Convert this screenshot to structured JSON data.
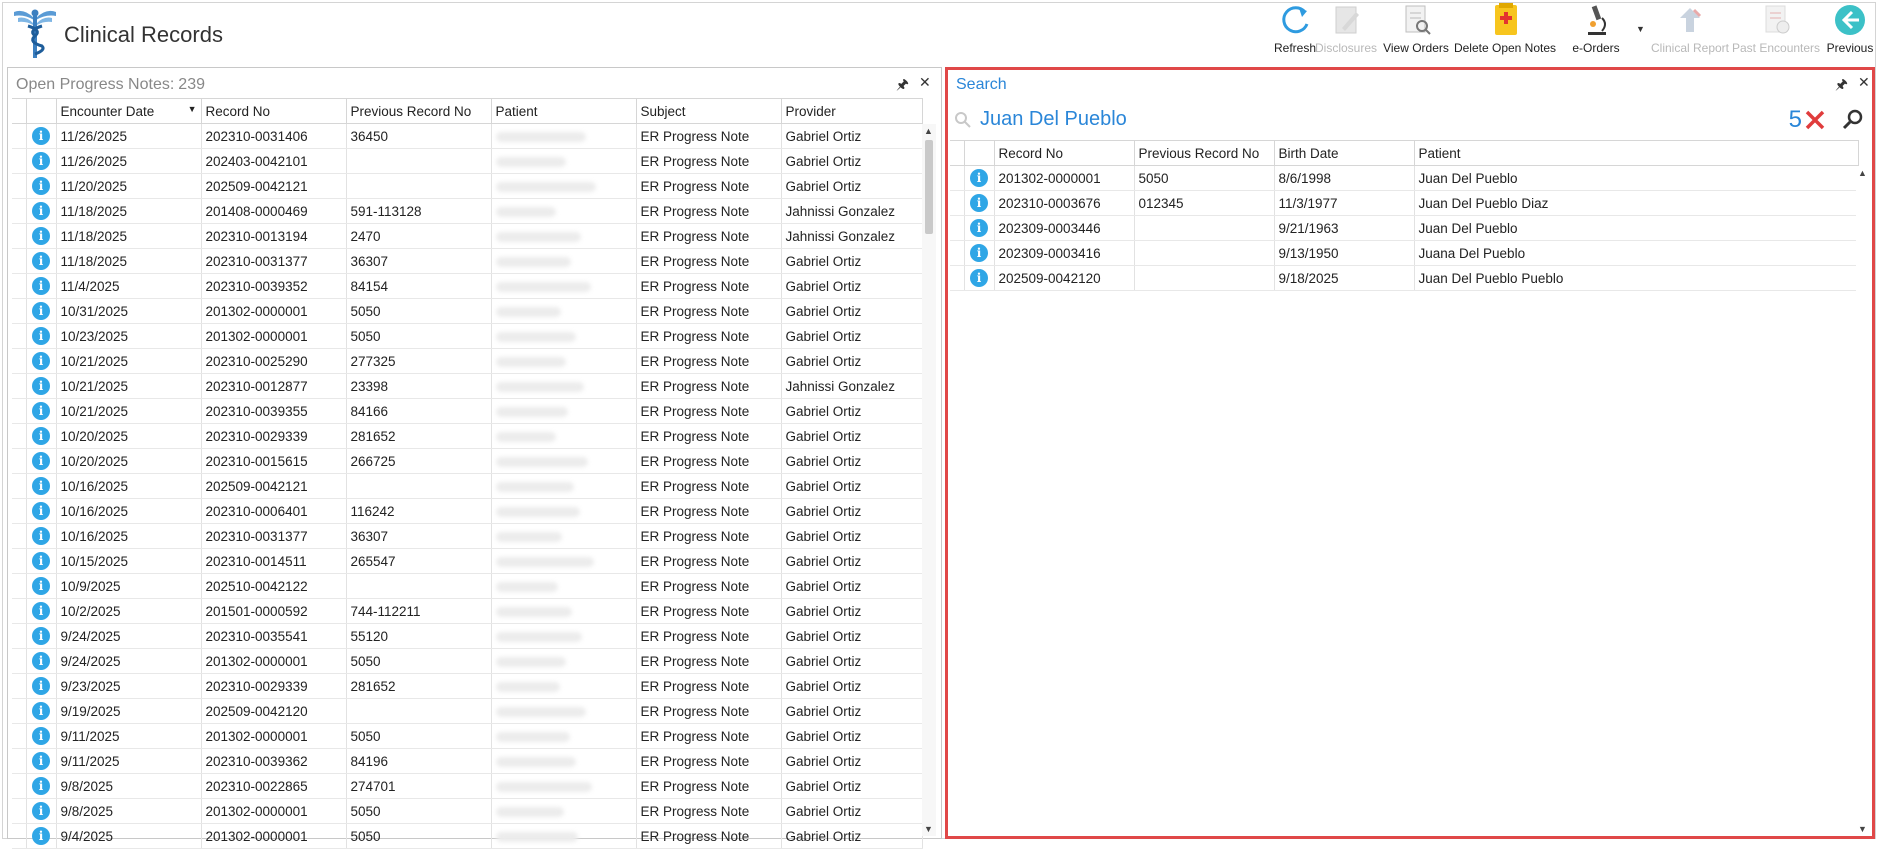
{
  "app": {
    "title": "Clinical Records"
  },
  "toolbar": [
    {
      "label": "Refresh",
      "icon": "refresh-icon",
      "enabled": true
    },
    {
      "label": "Disclosures",
      "icon": "disclosures-icon",
      "enabled": false
    },
    {
      "label": "View Orders",
      "icon": "view-orders-icon",
      "enabled": true
    },
    {
      "label": "Delete Open Notes",
      "icon": "delete-open-notes-icon",
      "enabled": true
    },
    {
      "label": "e-Orders",
      "icon": "microscope-icon",
      "enabled": true
    },
    {
      "label": "Clinical Report",
      "icon": "clinical-report-icon",
      "enabled": false
    },
    {
      "label": "Past Encounters",
      "icon": "past-encounters-icon",
      "enabled": false
    },
    {
      "label": "Previous",
      "icon": "previous-arrow-icon",
      "enabled": true
    }
  ],
  "left_panel": {
    "title": "Open Progress Notes:",
    "count": "239",
    "columns": [
      "",
      "Encounter Date",
      "Record No",
      "Previous Record No",
      "Patient",
      "Subject",
      "Provider"
    ],
    "rows": [
      [
        "11/26/2025",
        "202310-0031406",
        "36450",
        "ER Progress Note",
        "Gabriel Ortiz"
      ],
      [
        "11/26/2025",
        "202403-0042101",
        "",
        "ER Progress Note",
        "Gabriel Ortiz"
      ],
      [
        "11/20/2025",
        "202509-0042121",
        "",
        "ER Progress Note",
        "Gabriel Ortiz"
      ],
      [
        "11/18/2025",
        "201408-0000469",
        "591-113128",
        "ER Progress Note",
        "Jahnissi Gonzalez"
      ],
      [
        "11/18/2025",
        "202310-0013194",
        "2470",
        "ER Progress Note",
        "Jahnissi Gonzalez"
      ],
      [
        "11/18/2025",
        "202310-0031377",
        "36307",
        "ER Progress Note",
        "Gabriel Ortiz"
      ],
      [
        "11/4/2025",
        "202310-0039352",
        "84154",
        "ER Progress Note",
        "Gabriel Ortiz"
      ],
      [
        "10/31/2025",
        "201302-0000001",
        "5050",
        "ER Progress Note",
        "Gabriel Ortiz"
      ],
      [
        "10/23/2025",
        "201302-0000001",
        "5050",
        "ER Progress Note",
        "Gabriel Ortiz"
      ],
      [
        "10/21/2025",
        "202310-0025290",
        "277325",
        "ER Progress Note",
        "Gabriel Ortiz"
      ],
      [
        "10/21/2025",
        "202310-0012877",
        "23398",
        "ER Progress Note",
        "Jahnissi Gonzalez"
      ],
      [
        "10/21/2025",
        "202310-0039355",
        "84166",
        "ER Progress Note",
        "Gabriel Ortiz"
      ],
      [
        "10/20/2025",
        "202310-0029339",
        "281652",
        "ER Progress Note",
        "Gabriel Ortiz"
      ],
      [
        "10/20/2025",
        "202310-0015615",
        "266725",
        "ER Progress Note",
        "Gabriel Ortiz"
      ],
      [
        "10/16/2025",
        "202509-0042121",
        "",
        "ER Progress Note",
        "Gabriel Ortiz"
      ],
      [
        "10/16/2025",
        "202310-0006401",
        "116242",
        "ER Progress Note",
        "Gabriel Ortiz"
      ],
      [
        "10/16/2025",
        "202310-0031377",
        "36307",
        "ER Progress Note",
        "Gabriel Ortiz"
      ],
      [
        "10/15/2025",
        "202310-0014511",
        "265547",
        "ER Progress Note",
        "Gabriel Ortiz"
      ],
      [
        "10/9/2025",
        "202510-0042122",
        "",
        "ER Progress Note",
        "Gabriel Ortiz"
      ],
      [
        "10/2/2025",
        "201501-0000592",
        "744-112211",
        "ER Progress Note",
        "Gabriel Ortiz"
      ],
      [
        "9/24/2025",
        "202310-0035541",
        "55120",
        "ER Progress Note",
        "Gabriel Ortiz"
      ],
      [
        "9/24/2025",
        "201302-0000001",
        "5050",
        "ER Progress Note",
        "Gabriel Ortiz"
      ],
      [
        "9/23/2025",
        "202310-0029339",
        "281652",
        "ER Progress Note",
        "Gabriel Ortiz"
      ],
      [
        "9/19/2025",
        "202509-0042120",
        "",
        "ER Progress Note",
        "Gabriel Ortiz"
      ],
      [
        "9/11/2025",
        "201302-0000001",
        "5050",
        "ER Progress Note",
        "Gabriel Ortiz"
      ],
      [
        "9/11/2025",
        "202310-0039362",
        "84196",
        "ER Progress Note",
        "Gabriel Ortiz"
      ],
      [
        "9/8/2025",
        "202310-0022865",
        "274701",
        "ER Progress Note",
        "Gabriel Ortiz"
      ],
      [
        "9/8/2025",
        "201302-0000001",
        "5050",
        "ER Progress Note",
        "Gabriel Ortiz"
      ],
      [
        "9/4/2025",
        "201302-0000001",
        "5050",
        "ER Progress Note",
        "Gabriel Ortiz"
      ]
    ]
  },
  "right_panel": {
    "title": "Search",
    "query": "Juan Del Pueblo",
    "result_count": "5",
    "columns": [
      "",
      "Record No",
      "Previous Record No",
      "Birth Date",
      "Patient"
    ],
    "rows": [
      [
        "201302-0000001",
        "5050",
        "8/6/1998",
        "Juan Del Pueblo"
      ],
      [
        "202310-0003676",
        "012345",
        "11/3/1977",
        "Juan Del Pueblo Diaz"
      ],
      [
        "202309-0003446",
        "",
        "9/21/1963",
        "Juan Del Pueblo"
      ],
      [
        "202309-0003416",
        "",
        "9/13/1950",
        "Juana Del Pueblo"
      ],
      [
        "202509-0042120",
        "",
        "9/18/2025",
        "Juan Del Pueblo Pueblo"
      ]
    ]
  },
  "colors": {
    "accent": "#2a86d8",
    "highlight_border": "#e04848",
    "info_icon": "#2fa6e6",
    "clear_x": "#e03c3c"
  }
}
